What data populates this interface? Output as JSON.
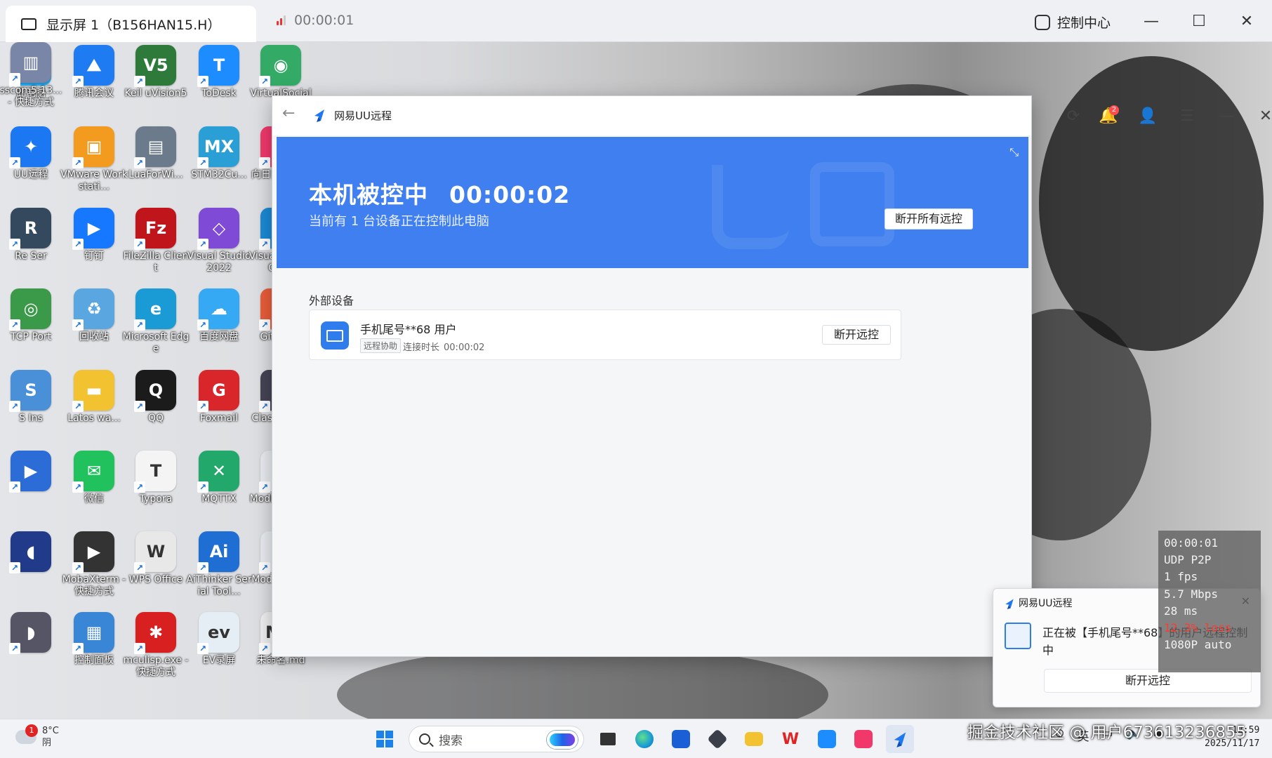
{
  "viewer": {
    "tab_label": "显示屏 1（B156HAN15.H）",
    "timer": "00:00:01",
    "control_center": "控制中心"
  },
  "desktop_icons": [
    {
      "label": "此电脑",
      "color": "#2aa4e8",
      "glyph": "▭"
    },
    {
      "label": "腾讯会议",
      "color": "#1e7bf2",
      "glyph": "⛰"
    },
    {
      "label": "Keil uVision5",
      "color": "#2d7a3a",
      "glyph": "V5"
    },
    {
      "label": "ToDesk",
      "color": "#1c8cff",
      "glyph": "T"
    },
    {
      "label": "VirtualSocial Pol",
      "color": "#3a6",
      "glyph": "◉"
    },
    {
      "label": "UU远程",
      "color": "#1c78f2",
      "glyph": "✦"
    },
    {
      "label": "VMware Workstati...",
      "color": "#f29b1e",
      "glyph": "▣"
    },
    {
      "label": "LuaForWi...",
      "color": "#6b7b8c",
      "glyph": "▤"
    },
    {
      "label": "STM32Cu...",
      "color": "#2a9fd6",
      "glyph": "MX"
    },
    {
      "label": "向日葵远程控制",
      "color": "#f2386b",
      "glyph": "▶"
    },
    {
      "label": "Re Ser",
      "color": "#34495e",
      "glyph": "R"
    },
    {
      "label": "钉钉",
      "color": "#1677ff",
      "glyph": "▶"
    },
    {
      "label": "FileZilla Client",
      "color": "#c0161b",
      "glyph": "Fz"
    },
    {
      "label": "Visual Studio 2022",
      "color": "#7f4bd6",
      "glyph": "◇"
    },
    {
      "label": "Visual Studio Code",
      "color": "#1b8ad6",
      "glyph": "◀"
    },
    {
      "label": "TCP Port",
      "color": "#3a9a4a",
      "glyph": "◎"
    },
    {
      "label": "回收站",
      "color": "#5aa6e0",
      "glyph": "♻"
    },
    {
      "label": "Microsoft Edge",
      "color": "#1a9bd6",
      "glyph": "e"
    },
    {
      "label": "百度网盘",
      "color": "#35a9f3",
      "glyph": "☁"
    },
    {
      "label": "Git Bash",
      "color": "#e85d3a",
      "glyph": "◆"
    },
    {
      "label": "S Ins",
      "color": "#4a90d9",
      "glyph": "S"
    },
    {
      "label": "Latos wa...",
      "color": "#f2c230",
      "glyph": "▬"
    },
    {
      "label": "QQ",
      "color": "#1b1b1b",
      "glyph": "Q"
    },
    {
      "label": "Foxmail",
      "color": "#d9262b",
      "glyph": "G"
    },
    {
      "label": "Clash Verge",
      "color": "#445",
      "glyph": "☺"
    },
    {
      "label": "",
      "color": "#2b6cd6",
      "glyph": "▶"
    },
    {
      "label": "微信",
      "color": "#21c25e",
      "glyph": "✉"
    },
    {
      "label": "Typora",
      "color": "#f4f4f4",
      "glyph": "T"
    },
    {
      "label": "MQTTX",
      "color": "#22a86a",
      "glyph": "✕"
    },
    {
      "label": "Modbus Slave",
      "color": "#e8ecf0",
      "glyph": "⌗"
    },
    {
      "label": "",
      "color": "#223a8a",
      "glyph": "◖"
    },
    {
      "label": "MobaXterm - 快捷方式",
      "color": "#333",
      "glyph": "▶"
    },
    {
      "label": "WPS Office",
      "color": "#e8e8e8",
      "glyph": "W"
    },
    {
      "label": "AiThinker Serial Tool...",
      "color": "#1f6ed4",
      "glyph": "Ai"
    },
    {
      "label": "Modbus Poll",
      "color": "#e8ecf0",
      "glyph": "⌗"
    },
    {
      "label": "",
      "color": "#556",
      "glyph": "◗"
    },
    {
      "label": "控制面板",
      "color": "#3a86d6",
      "glyph": "▦"
    },
    {
      "label": "mculisp.exe - 快捷方式",
      "color": "#d92020",
      "glyph": "✱"
    },
    {
      "label": "EV录屏",
      "color": "#e6eef5",
      "glyph": "ev"
    },
    {
      "label": "未命名.md",
      "color": "#f0f0f0",
      "glyph": "M↓"
    },
    {
      "label": "sscom5.13... - 快捷方式",
      "color": "#7a86a8",
      "glyph": "▥"
    }
  ],
  "uu": {
    "title": "网易UU远程",
    "notif_count": "2",
    "banner_status": "本机被控中",
    "banner_timer": "00:00:02",
    "banner_sub": "当前有 1 台设备正在控制此电脑",
    "disconnect_all": "断开所有远控",
    "section_title": "外部设备",
    "device_name": "手机尾号**68 用户",
    "device_tag": "远程协助",
    "device_duration_label": "连接时长",
    "device_duration": "00:00:02",
    "disconnect": "断开远控",
    "accent": "#3f7fef"
  },
  "stats": {
    "time": "00:00:01",
    "mode": "UDP P2P",
    "fps": "1 fps",
    "rate": "5.7 Mbps",
    "latency": "28 ms",
    "loss": "12.3% loss",
    "quality": "1080P auto"
  },
  "toast": {
    "title": "网易UU远程",
    "message": "正在被【手机尾号**68】的用户远程控制中",
    "button": "断开远控"
  },
  "taskbar": {
    "weather_temp": "8°C",
    "weather_desc": "阴",
    "weather_badge": "1",
    "search_placeholder": "搜索",
    "ime": "英",
    "time": "12:59",
    "date": "2025/11/17"
  },
  "overlay_watermark": "掘金技术社区 @ 用户673613236855"
}
